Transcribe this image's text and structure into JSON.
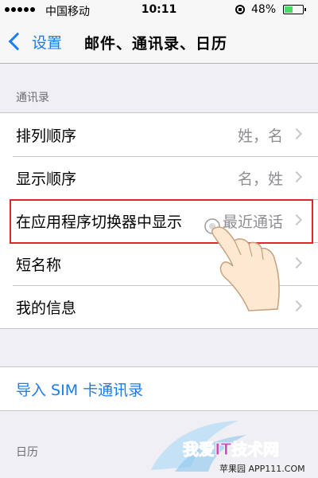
{
  "status_bar": {
    "carrier": "中国移动",
    "time": "10:11",
    "battery_percent": "48%",
    "battery_level": 0.48
  },
  "nav": {
    "back_label": "设置",
    "title": "邮件、通讯录、日历"
  },
  "contacts_section": {
    "header": "通讯录",
    "rows": [
      {
        "label": "排列顺序",
        "value": "姓，名"
      },
      {
        "label": "显示顺序",
        "value": "名，姓"
      },
      {
        "label": "在应用程序切换器中显示",
        "value": "最近通话"
      },
      {
        "label": "短名称",
        "value": ""
      },
      {
        "label": "我的信息",
        "value": ""
      }
    ]
  },
  "import_sim_label": "导入 SIM 卡通讯录",
  "calendar_section": {
    "header": "日历"
  },
  "watermark": {
    "brand": "我爱IT技术网",
    "site": "苹果园 APP111.COM"
  },
  "colors": {
    "accent": "#1a7cf2",
    "highlight": "#e0262b",
    "battery": "#4cd964"
  }
}
